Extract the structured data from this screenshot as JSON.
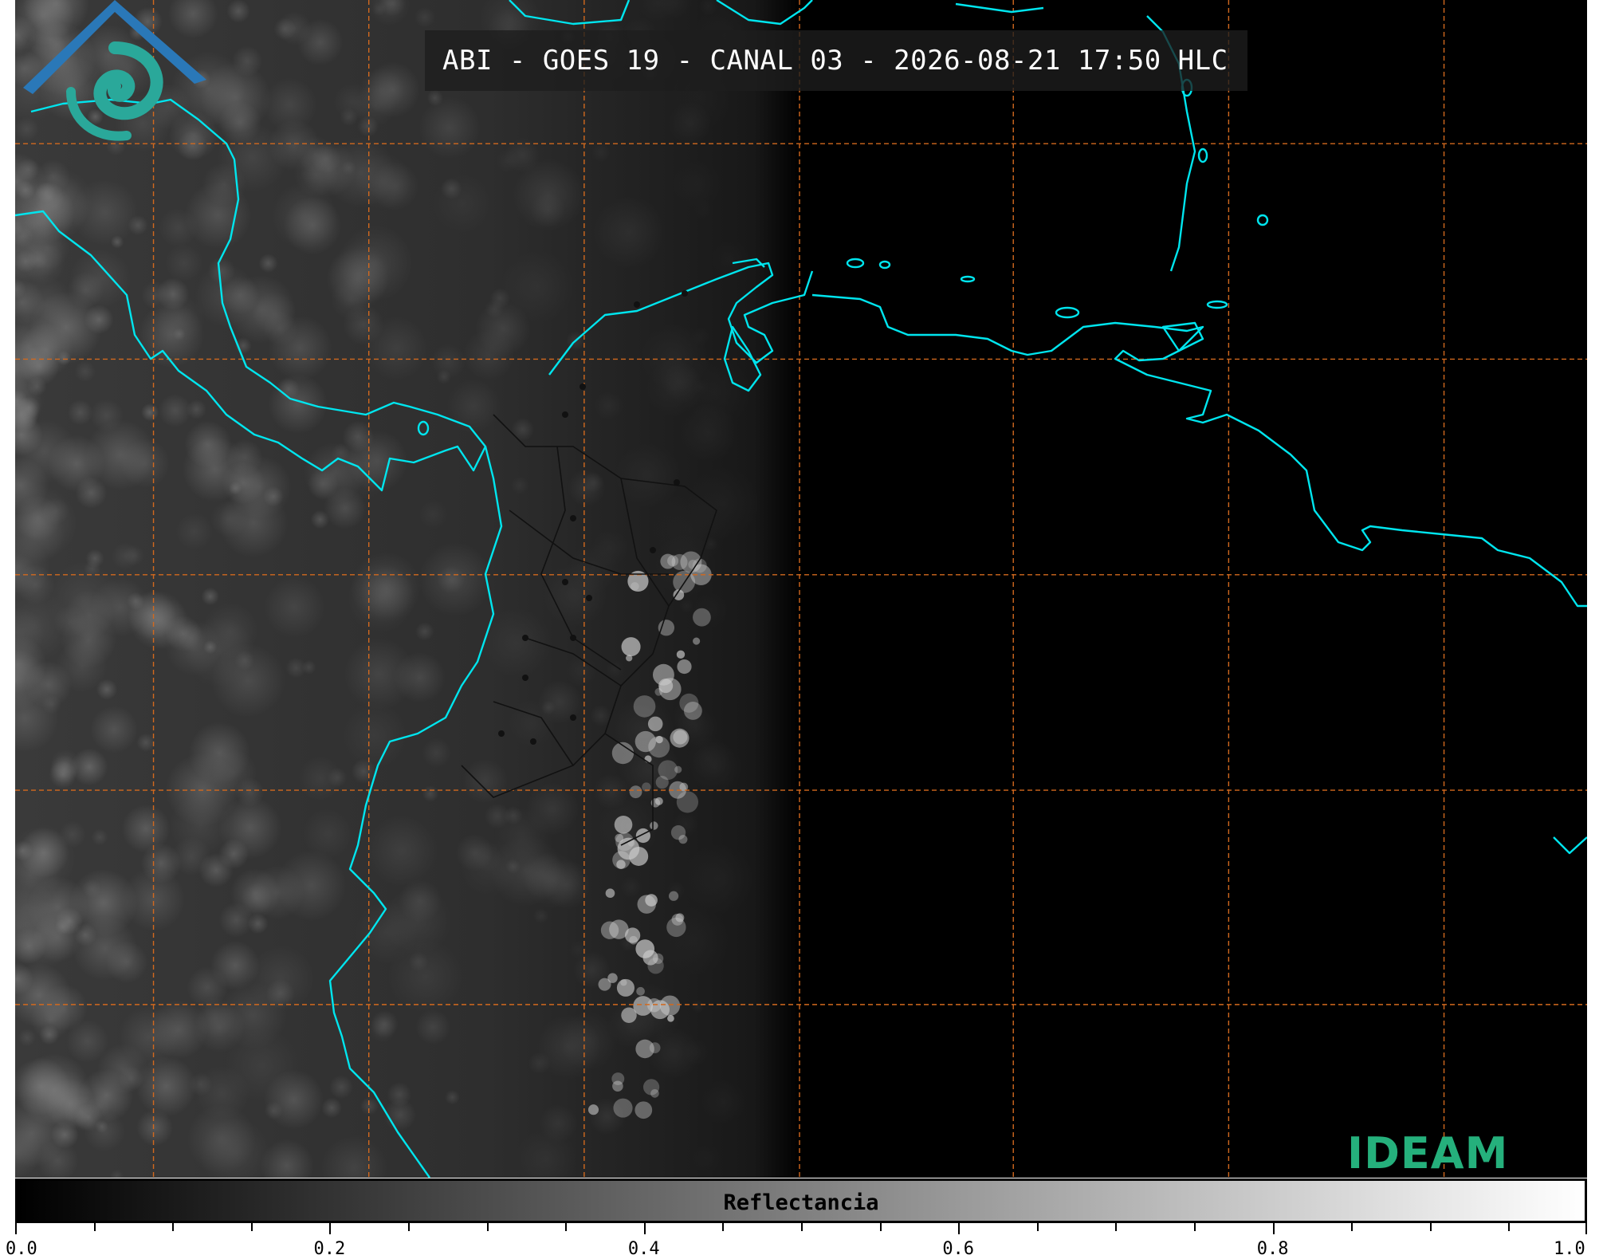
{
  "title": "ABI - GOES 19 - CANAL 03 - 2026-08-21 17:50 HLC",
  "colorbar": {
    "label": "Reflectancia",
    "min": 0.0,
    "max": 1.0,
    "ticks": [
      "0.0",
      "0.2",
      "0.4",
      "0.6",
      "0.8",
      "1.0"
    ],
    "minor_step": 0.05,
    "gradient_start": "#000000",
    "gradient_end": "#ffffff"
  },
  "logo": {
    "text": "IDEAM",
    "roof_color": "#2a78b8",
    "swirl_color": "#2aa89a",
    "text_color": "#25b07c"
  },
  "map": {
    "background": "#000000",
    "coastline_color": "#00e5ee",
    "borders_color": "#111111",
    "gridline_color": "#d2691e",
    "gridline_style": "dashed"
  }
}
